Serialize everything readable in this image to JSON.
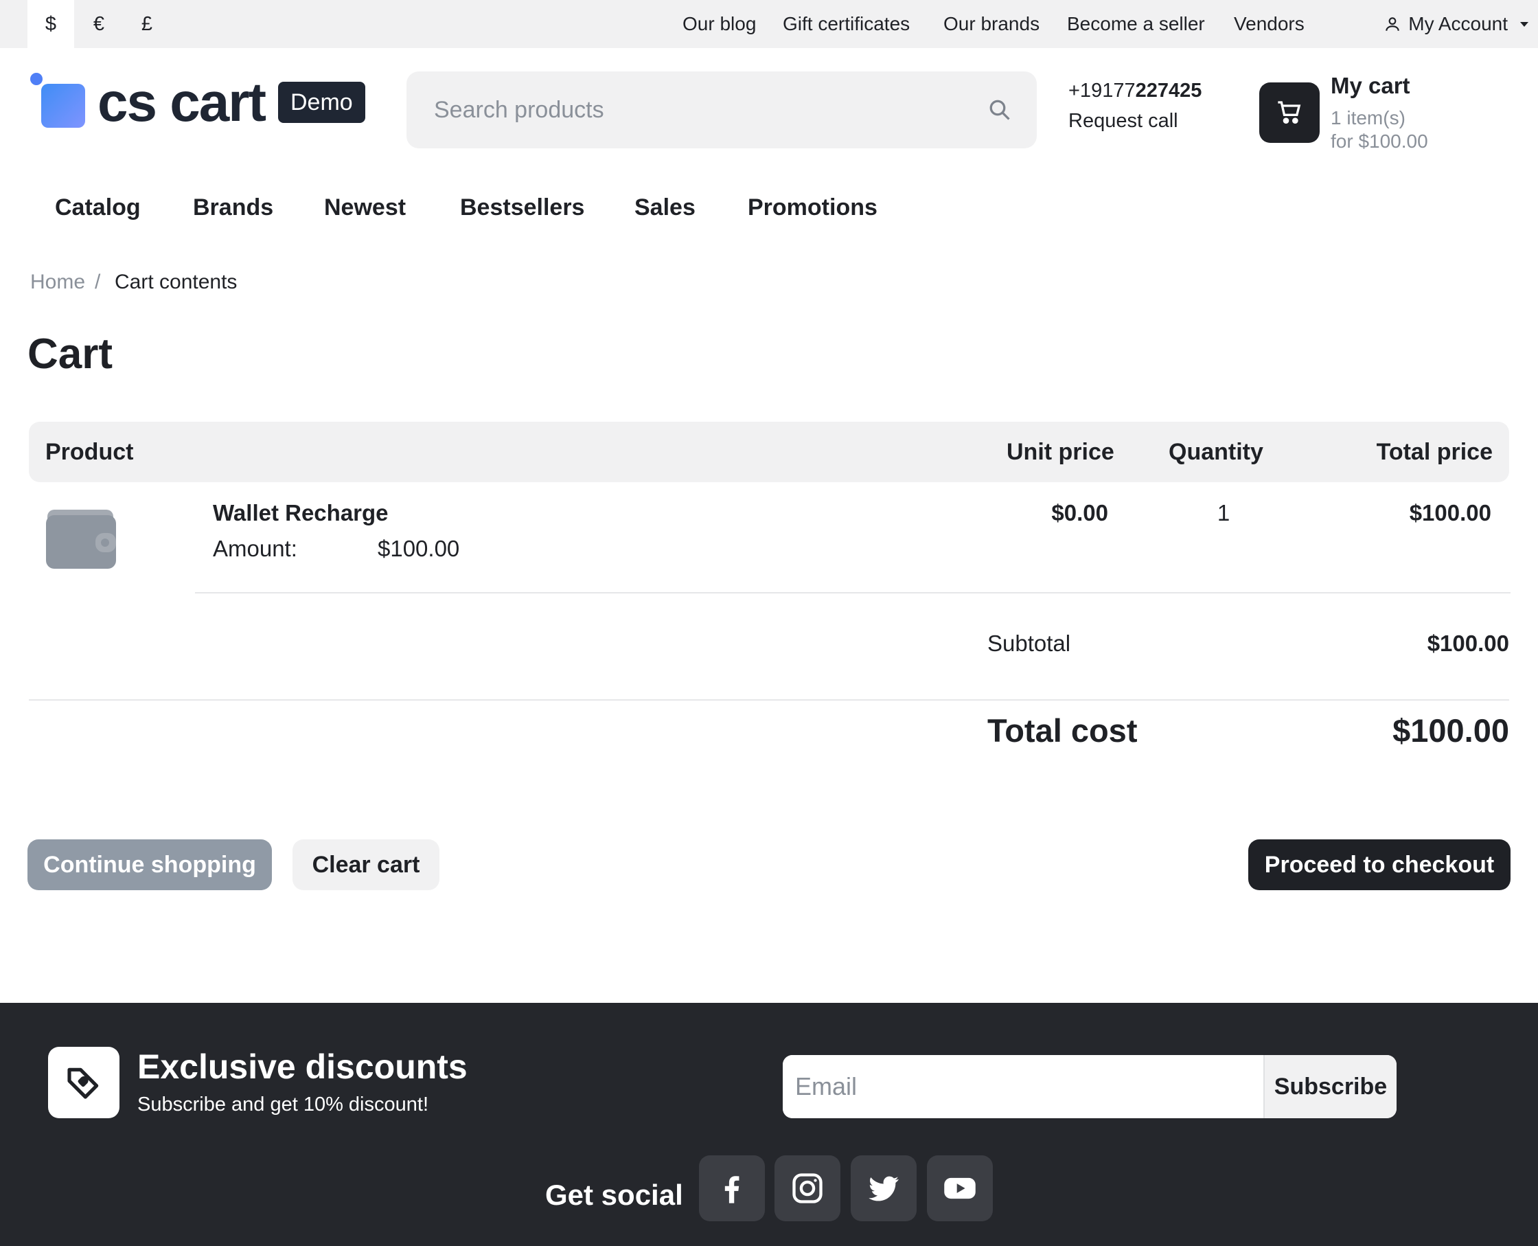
{
  "topbar": {
    "currencies": [
      "$",
      "€",
      "£"
    ],
    "links": [
      "Our blog",
      "Gift certificates",
      "Our brands",
      "Become a seller",
      "Vendors"
    ],
    "account_label": "My Account"
  },
  "header": {
    "logo_text": "cs cart",
    "logo_badge": "Demo",
    "search_placeholder": "Search products",
    "phone_prefix": "+19177",
    "phone_suffix": "227425",
    "request_call": "Request call",
    "cart_title": "My cart",
    "cart_items": "1 item(s)",
    "cart_total": "for $100.00"
  },
  "nav": [
    "Catalog",
    "Brands",
    "Newest",
    "Bestsellers",
    "Sales",
    "Promotions"
  ],
  "breadcrumb": {
    "home": "Home",
    "separator": "/",
    "current": "Cart contents"
  },
  "page_title": "Cart",
  "table": {
    "headers": {
      "product": "Product",
      "unit_price": "Unit price",
      "quantity": "Quantity",
      "total_price": "Total price"
    },
    "rows": [
      {
        "name": "Wallet Recharge",
        "option_label": "Amount:",
        "option_value": "$100.00",
        "unit_price": "$0.00",
        "quantity": "1",
        "total": "$100.00",
        "image_icon": "wallet-icon"
      }
    ]
  },
  "totals": {
    "subtotal_label": "Subtotal",
    "subtotal_value": "$100.00",
    "total_label": "Total cost",
    "total_value": "$100.00"
  },
  "actions": {
    "continue": "Continue shopping",
    "clear": "Clear cart",
    "checkout": "Proceed to checkout"
  },
  "footer": {
    "discount_title": "Exclusive discounts",
    "discount_subtitle": "Subscribe and get 10% discount!",
    "email_placeholder": "Email",
    "subscribe": "Subscribe",
    "social_label": "Get social",
    "social_icons": [
      "facebook-icon",
      "instagram-icon",
      "twitter-icon",
      "youtube-icon"
    ]
  },
  "colors": {
    "dark": "#1f2126",
    "footer_bg": "#25272c",
    "muted_button": "#909aa6",
    "light_gray": "#f1f1f2",
    "logo_accent": "#4f7ff6"
  }
}
